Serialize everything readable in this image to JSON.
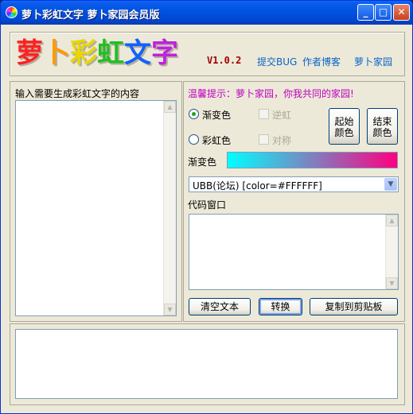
{
  "window": {
    "title": "萝卜彩虹文字   萝卜家园会员版",
    "minimize": "_",
    "maximize": "□",
    "close": "✕"
  },
  "banner": {
    "logo_chars": [
      {
        "char": "萝",
        "color": "#ff2020"
      },
      {
        "char": "卜",
        "color": "#ff9a00"
      },
      {
        "char": "彩",
        "color": "#e8d800"
      },
      {
        "char": "虹",
        "color": "#20c020"
      },
      {
        "char": "文",
        "color": "#1060ff"
      },
      {
        "char": "字",
        "color": "#c020e0"
      }
    ],
    "version": "V1.0.2",
    "links": [
      "提交BUG",
      "作者博客",
      "萝卜家园"
    ]
  },
  "left": {
    "label": "输入需要生成彩虹文字的内容",
    "input_value": ""
  },
  "right": {
    "tip": "温馨提示：萝卜家园，你我共同的家园!",
    "radio_gradient": "渐变色",
    "radio_rainbow": "彩虹色",
    "check_reverse": "逆虹",
    "check_symmetric": "对称",
    "start_color_button": "起始\n颜色",
    "end_color_button": "结束\n颜色",
    "gradient_label": "渐变色",
    "gradient_from": "#00ffff",
    "gradient_to": "#ff0080",
    "format_selected": "UBB(论坛) [color=#FFFFFF]",
    "code_label": "代码窗口",
    "code_value": "",
    "clear_button": "清空文本",
    "convert_button": "转换",
    "copy_button": "复制到剪贴板"
  },
  "preview": {
    "content": ""
  },
  "icons": {
    "scroll_up": "▲",
    "scroll_down": "▼",
    "dropdown": "▼"
  }
}
